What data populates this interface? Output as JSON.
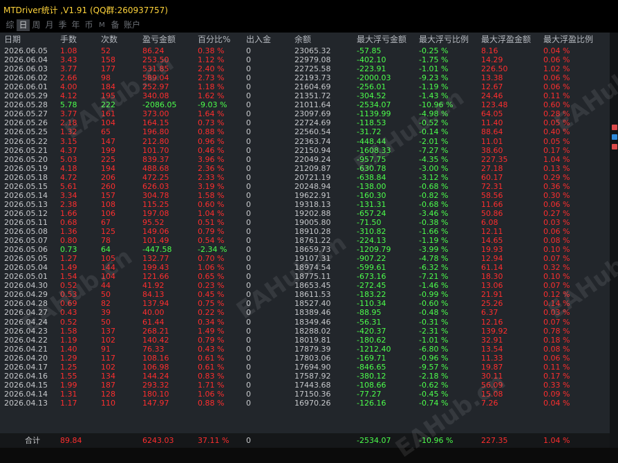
{
  "window": {
    "title": "MTDriver统计 ,V1.91 (QQ群:260937757)"
  },
  "tabs": [
    {
      "label": "综",
      "active": false
    },
    {
      "label": "日",
      "active": true
    },
    {
      "label": "周",
      "active": false
    },
    {
      "label": "月",
      "active": false
    },
    {
      "label": "季",
      "active": false
    },
    {
      "label": "年",
      "active": false
    },
    {
      "label": "币",
      "active": false
    },
    {
      "label": "M",
      "active": false
    },
    {
      "label": "备",
      "active": false
    },
    {
      "label": "账户",
      "active": false
    }
  ],
  "table": {
    "headers": [
      "日期",
      "手数",
      "次数",
      "盈亏金额",
      "百分比%",
      "出入金",
      "余额",
      "最大浮亏金额",
      "最大浮亏比例",
      "最大浮盈金额",
      "最大浮盈比例"
    ],
    "rows": [
      [
        "2026.06.05",
        "1.08",
        "52",
        "86.24",
        "0.38 %",
        "0",
        "23065.32",
        "-57.85",
        "-0.25 %",
        "8.16",
        "0.04 %"
      ],
      [
        "2026.06.04",
        "3.43",
        "158",
        "253.50",
        "1.12 %",
        "0",
        "22979.08",
        "-402.10",
        "-1.75 %",
        "14.29",
        "0.06 %"
      ],
      [
        "2026.06.03",
        "3.77",
        "177",
        "531.85",
        "2.40 %",
        "0",
        "22725.58",
        "-223.91",
        "-1.01 %",
        "226.50",
        "1.02 %"
      ],
      [
        "2026.06.02",
        "2.66",
        "98",
        "589.04",
        "2.73 %",
        "0",
        "22193.73",
        "-2000.03",
        "-9.23 %",
        "13.38",
        "0.06 %"
      ],
      [
        "2026.06.01",
        "4.00",
        "184",
        "252.97",
        "1.18 %",
        "0",
        "21604.69",
        "-256.01",
        "-1.19 %",
        "12.67",
        "0.06 %"
      ],
      [
        "2026.05.29",
        "4.12",
        "195",
        "340.08",
        "1.62 %",
        "0",
        "21351.72",
        "-304.52",
        "-1.43 %",
        "24.46",
        "0.11 %"
      ],
      [
        "2026.05.28",
        "5.78",
        "222",
        "-2086.05",
        "-9.03 %",
        "0",
        "21011.64",
        "-2534.07",
        "-10.96 %",
        "123.48",
        "0.60 %"
      ],
      [
        "2026.05.27",
        "3.77",
        "161",
        "373.00",
        "1.64 %",
        "0",
        "23097.69",
        "-1139.99",
        "-4.98 %",
        "64.05",
        "0.28 %"
      ],
      [
        "2026.05.26",
        "2.18",
        "104",
        "164.15",
        "0.73 %",
        "0",
        "22724.69",
        "-118.53",
        "-0.52 %",
        "11.40",
        "0.05 %"
      ],
      [
        "2026.05.25",
        "1.32",
        "65",
        "196.80",
        "0.88 %",
        "0",
        "22560.54",
        "-31.72",
        "-0.14 %",
        "88.64",
        "0.40 %"
      ],
      [
        "2026.05.22",
        "3.15",
        "147",
        "212.80",
        "0.96 %",
        "0",
        "22363.74",
        "-448.44",
        "-2.01 %",
        "11.01",
        "0.05 %"
      ],
      [
        "2026.05.21",
        "4.37",
        "199",
        "101.70",
        "0.46 %",
        "0",
        "22150.94",
        "-1608.33",
        "-7.27 %",
        "38.60",
        "0.17 %"
      ],
      [
        "2026.05.20",
        "5.03",
        "225",
        "839.37",
        "3.96 %",
        "0",
        "22049.24",
        "-957.75",
        "-4.35 %",
        "227.35",
        "1.04 %"
      ],
      [
        "2026.05.19",
        "4.18",
        "194",
        "488.68",
        "2.36 %",
        "0",
        "21209.87",
        "-630.78",
        "-3.00 %",
        "27.18",
        "0.13 %"
      ],
      [
        "2026.05.18",
        "4.72",
        "206",
        "472.25",
        "2.33 %",
        "0",
        "20721.19",
        "-638.84",
        "-3.12 %",
        "60.17",
        "0.29 %"
      ],
      [
        "2026.05.15",
        "5.61",
        "260",
        "626.03",
        "3.19 %",
        "0",
        "20248.94",
        "-138.00",
        "-0.68 %",
        "72.31",
        "0.36 %"
      ],
      [
        "2026.05.14",
        "3.34",
        "157",
        "304.78",
        "1.58 %",
        "0",
        "19622.91",
        "-160.30",
        "-0.82 %",
        "58.56",
        "0.30 %"
      ],
      [
        "2026.05.13",
        "2.38",
        "108",
        "115.25",
        "0.60 %",
        "0",
        "19318.13",
        "-131.31",
        "-0.68 %",
        "11.66",
        "0.06 %"
      ],
      [
        "2026.05.12",
        "1.66",
        "106",
        "197.08",
        "1.04 %",
        "0",
        "19202.88",
        "-657.24",
        "-3.46 %",
        "50.86",
        "0.27 %"
      ],
      [
        "2026.05.11",
        "0.68",
        "67",
        "95.52",
        "0.51 %",
        "0",
        "19005.80",
        "-71.50",
        "-0.38 %",
        "6.08",
        "0.03 %"
      ],
      [
        "2026.05.08",
        "1.36",
        "125",
        "149.06",
        "0.79 %",
        "0",
        "18910.28",
        "-310.82",
        "-1.66 %",
        "12.11",
        "0.06 %"
      ],
      [
        "2026.05.07",
        "0.80",
        "78",
        "101.49",
        "0.54 %",
        "0",
        "18761.22",
        "-224.13",
        "-1.19 %",
        "14.65",
        "0.08 %"
      ],
      [
        "2026.05.06",
        "0.73",
        "64",
        "-447.58",
        "-2.34 %",
        "0",
        "18659.73",
        "-1209.79",
        "-3.99 %",
        "19.93",
        "0.10 %"
      ],
      [
        "2026.05.05",
        "1.27",
        "105",
        "132.77",
        "0.70 %",
        "0",
        "19107.31",
        "-907.22",
        "-4.78 %",
        "12.94",
        "0.07 %"
      ],
      [
        "2026.05.04",
        "1.49",
        "144",
        "199.43",
        "1.06 %",
        "0",
        "18974.54",
        "-599.61",
        "-6.32 %",
        "61.14",
        "0.32 %"
      ],
      [
        "2026.05.01",
        "1.54",
        "104",
        "121.66",
        "0.65 %",
        "0",
        "18775.11",
        "-673.16",
        "-7.21 %",
        "18.30",
        "0.10 %"
      ],
      [
        "2026.04.30",
        "0.52",
        "44",
        "41.92",
        "0.23 %",
        "0",
        "18653.45",
        "-272.45",
        "-1.46 %",
        "13.06",
        "0.07 %"
      ],
      [
        "2026.04.29",
        "0.53",
        "50",
        "84.13",
        "0.45 %",
        "0",
        "18611.53",
        "-183.22",
        "-0.99 %",
        "21.91",
        "0.12 %"
      ],
      [
        "2026.04.28",
        "0.69",
        "82",
        "137.94",
        "0.75 %",
        "0",
        "18527.40",
        "-110.34",
        "-0.60 %",
        "25.26",
        "0.14 %"
      ],
      [
        "2026.04.27",
        "0.43",
        "39",
        "40.00",
        "0.22 %",
        "0",
        "18389.46",
        "-88.95",
        "-0.48 %",
        "6.37",
        "0.03 %"
      ],
      [
        "2026.04.24",
        "0.52",
        "50",
        "61.44",
        "0.34 %",
        "0",
        "18349.46",
        "-56.31",
        "-0.31 %",
        "12.16",
        "0.07 %"
      ],
      [
        "2026.04.23",
        "1.58",
        "137",
        "268.21",
        "1.49 %",
        "0",
        "18288.02",
        "-420.37",
        "-2.31 %",
        "139.92",
        "0.78 %"
      ],
      [
        "2026.04.22",
        "1.19",
        "102",
        "140.42",
        "0.79 %",
        "0",
        "18019.81",
        "-180.62",
        "-1.01 %",
        "32.91",
        "0.18 %"
      ],
      [
        "2026.04.21",
        "1.40",
        "91",
        "76.33",
        "0.43 %",
        "0",
        "17879.39",
        "-1212.40",
        "-6.80 %",
        "13.54",
        "0.08 %"
      ],
      [
        "2026.04.20",
        "1.29",
        "117",
        "108.16",
        "0.61 %",
        "0",
        "17803.06",
        "-169.71",
        "-0.96 %",
        "11.33",
        "0.06 %"
      ],
      [
        "2026.04.17",
        "1.25",
        "102",
        "106.98",
        "0.61 %",
        "0",
        "17694.90",
        "-846.65",
        "-9.57 %",
        "19.87",
        "0.11 %"
      ],
      [
        "2026.04.16",
        "1.55",
        "134",
        "144.24",
        "0.83 %",
        "0",
        "17587.92",
        "-380.12",
        "-2.18 %",
        "30.11",
        "0.17 %"
      ],
      [
        "2026.04.15",
        "1.99",
        "187",
        "293.32",
        "1.71 %",
        "0",
        "17443.68",
        "-108.66",
        "-0.62 %",
        "56.09",
        "0.33 %"
      ],
      [
        "2026.04.14",
        "1.31",
        "128",
        "180.10",
        "1.06 %",
        "0",
        "17150.36",
        "-77.27",
        "-0.45 %",
        "15.08",
        "0.09 %"
      ],
      [
        "2026.04.13",
        "1.17",
        "110",
        "147.97",
        "0.88 %",
        "0",
        "16970.26",
        "-126.16",
        "-0.74 %",
        "7.26",
        "0.04 %"
      ]
    ],
    "total": {
      "label": "合计",
      "lots": "89.84",
      "profit": "6243.03",
      "percent": "37.11 %",
      "deposit": "0",
      "max_float_loss": "-2534.07",
      "max_float_loss_pct": "-10.96 %",
      "max_float_profit": "227.35",
      "max_float_profit_pct": "1.04 %"
    }
  },
  "colors": {
    "profit": "#ff2e2e",
    "loss": "#4cff4c",
    "title": "#ffd43b",
    "text": "#c7c9cc"
  },
  "watermark": "EAHub.cn"
}
